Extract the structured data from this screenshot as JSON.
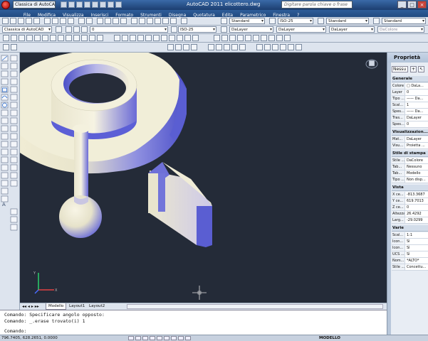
{
  "titlebar": {
    "workspace": "Classica di AutoCAD",
    "title": "AutoCAD 2011   elicottero.dwg",
    "search_placeholder": "Digitare parola chiave o frase",
    "minimize": "_",
    "maximize": "□",
    "close": "×"
  },
  "menubar": {
    "items": [
      "File",
      "Modifica",
      "Visualizza",
      "Inserisci",
      "Formato",
      "Strumenti",
      "Disegna",
      "Quotatura",
      "Edita",
      "Parametrico",
      "Finestra",
      "?"
    ]
  },
  "toolbars": {
    "text_style": "Standard",
    "dim_style": "ISO-25",
    "table_style": "Standard",
    "multileader_style": "Standard",
    "workspace_select": "Classica di AutoCAD",
    "layer": "0",
    "dim_style_2": "ISO-25",
    "color": "DaLayer",
    "linetype": "DaLayer",
    "lineweight": "DaLayer",
    "plotstyle": "DaColore"
  },
  "tabs": {
    "model": "Modello",
    "layout1": "Layout1",
    "layout2": "Layout2"
  },
  "command": {
    "line1": "Comando: Specificare angolo opposto:",
    "line2": "Comando: _.erase trovato(i) 1",
    "line3": "Comando:"
  },
  "statusbar": {
    "coords": "796.7405, 628.2651, 0.0000",
    "mode": "MODELLO"
  },
  "properties": {
    "title": "Proprietà",
    "selection": "Nessu",
    "sections": {
      "generale": "Generale",
      "visualizzazione": "Visualizzazion...",
      "stile_stampa": "Stile di stampa",
      "vista": "Vista",
      "varie": "Varie"
    },
    "generale_rows": [
      {
        "k": "Colore",
        "v": "□ DaLa..."
      },
      {
        "k": "Layer",
        "v": "0"
      },
      {
        "k": "Tipo ...",
        "v": "—— Da..."
      },
      {
        "k": "Scal...",
        "v": "1"
      },
      {
        "k": "Spes...",
        "v": "—— Da..."
      },
      {
        "k": "Tras...",
        "v": "DaLayer"
      },
      {
        "k": "Spes...",
        "v": "0"
      }
    ],
    "vis_rows": [
      {
        "k": "Mat...",
        "v": "DaLayer"
      },
      {
        "k": "Visu...",
        "v": "Proietta ..."
      }
    ],
    "stampa_rows": [
      {
        "k": "Stile ...",
        "v": "DaColore"
      },
      {
        "k": "Tab...",
        "v": "Nessuno"
      },
      {
        "k": "Tab...",
        "v": "Modello"
      },
      {
        "k": "Tipo ...",
        "v": "Non disp..."
      }
    ],
    "vista_rows": [
      {
        "k": "X ce...",
        "v": "-813.3687"
      },
      {
        "k": "Y ce...",
        "v": "619.7013"
      },
      {
        "k": "Z ce...",
        "v": "0"
      },
      {
        "k": "Altezza",
        "v": "26.4292"
      },
      {
        "k": "Larg...",
        "v": "-29.0299"
      }
    ],
    "varie_rows": [
      {
        "k": "Scal...",
        "v": "1:1"
      },
      {
        "k": "Icon...",
        "v": "Sì"
      },
      {
        "k": "Icon...",
        "v": "Sì"
      },
      {
        "k": "UCS ...",
        "v": "Sì"
      },
      {
        "k": "Nom...",
        "v": "*ALTO*"
      },
      {
        "k": "Stile ...",
        "v": "Concettu..."
      }
    ]
  },
  "colors": {
    "viewport_bg": "#242b38",
    "model_face": "#f2eed8",
    "model_shadow": "#5c5fd6",
    "title_blue": "#1c3e70"
  }
}
